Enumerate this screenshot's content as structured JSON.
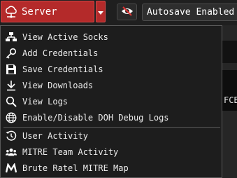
{
  "toolbar": {
    "server_label": "Server",
    "autosave_label": "Autosave Enabled"
  },
  "background": {
    "partial_text": "FCB"
  },
  "menu": {
    "items": [
      {
        "label": "View Active Socks",
        "icon": "network-icon"
      },
      {
        "label": "Add Credentials",
        "icon": "key-icon"
      },
      {
        "label": "Save Credentials",
        "icon": "floppy-disk-icon"
      },
      {
        "label": "View Downloads",
        "icon": "download-icon"
      },
      {
        "label": "View Logs",
        "icon": "magnifier-icon"
      },
      {
        "label": "Enable/Disable DOH Debug Logs",
        "icon": "globe-icon"
      },
      {
        "label": "User Activity",
        "icon": "history-icon"
      },
      {
        "label": "MITRE Team Activity",
        "icon": "team-icon"
      },
      {
        "label": "Brute Ratel MITRE Map",
        "icon": "mitre-logo-icon"
      }
    ]
  },
  "colors": {
    "accent_red": "#b42a2a",
    "menu_bg": "#1d1d1d"
  }
}
